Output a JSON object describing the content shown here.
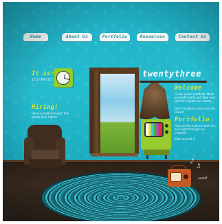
{
  "nav": {
    "items": [
      "Home",
      "About Us",
      "Portfolio",
      "Resources",
      "Contact Us"
    ]
  },
  "site": {
    "title": "twentythree"
  },
  "left": {
    "time_title": "It is:",
    "time_text": "12:17 PM CDT",
    "hiring_title": "Hiring!",
    "hiring_text": "Have a read and we'll talk about your future."
  },
  "right": {
    "welcome_title": "Welcome",
    "welcome_text": "to our online portfolio. Make yourself comfy and take your time to explore our rooms.",
    "welcome_more": "Don't forget to check out the closet!",
    "portfolio_title": "Portfolio",
    "portfolio_text": "Click on the tube to have fun and sight through our projects.",
    "portfolio_more": "Look around :)"
  },
  "radio": {
    "label": "on/off"
  },
  "colors": {
    "wall": "#1fb0c4",
    "accent": "#d8e83a",
    "tv": "#98cc2e",
    "radio": "#c35a24"
  }
}
